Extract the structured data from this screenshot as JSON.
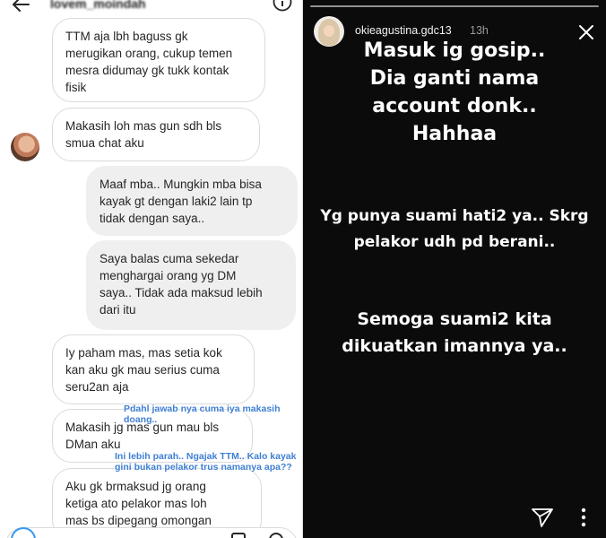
{
  "dm": {
    "header_title": "lovem_moindah",
    "messages": [
      {
        "text": "TTM aja lbh baguss gk\nmerugikan orang, cukup temen\nmesra didumay gk tukk kontak\nfisik"
      },
      {
        "text": "Makasih loh mas gun sdh bls\nsmua chat aku"
      },
      {
        "text": "Maaf mba.. Mungkin mba bisa\nkayak gt dengan laki2 lain tp\ntidak dengan saya.."
      },
      {
        "text": "Saya balas cuma sekedar\nmenghargai orang yg DM\nsaya.. Tidak ada maksud lebih\ndari itu"
      },
      {
        "text": "Iy paham mas, mas setia kok\nkan aku gk mau serius cuma\nseru2an aja"
      },
      {
        "text": "Makasih jg mas gun mau bls\nDMan aku"
      },
      {
        "text": "Aku gk brmaksud jg orang\nketiga ato pelakor mas loh\nmas bs dipegang omongan"
      }
    ],
    "annotations": [
      "Pdahl jawab nya cuma iya makasih\ndoang..",
      "Ini lebih parah.. Ngajak TTM.. Kalo kayak\ngini bukan pelakor trus namanya apa??"
    ],
    "accent_color": "#3797f0"
  },
  "story": {
    "username": "okieagustina.gdc13",
    "time": "13h",
    "text_blocks": [
      "Masuk ig gosip..\nDia ganti nama\naccount donk..\nHahhaa",
      "Yg punya suami hati2 ya.. Skrg\npelakor udh pd berani..",
      "Semoga suami2 kita\ndikuatkan imannya ya.."
    ],
    "background_color": "#0b0b0b"
  }
}
